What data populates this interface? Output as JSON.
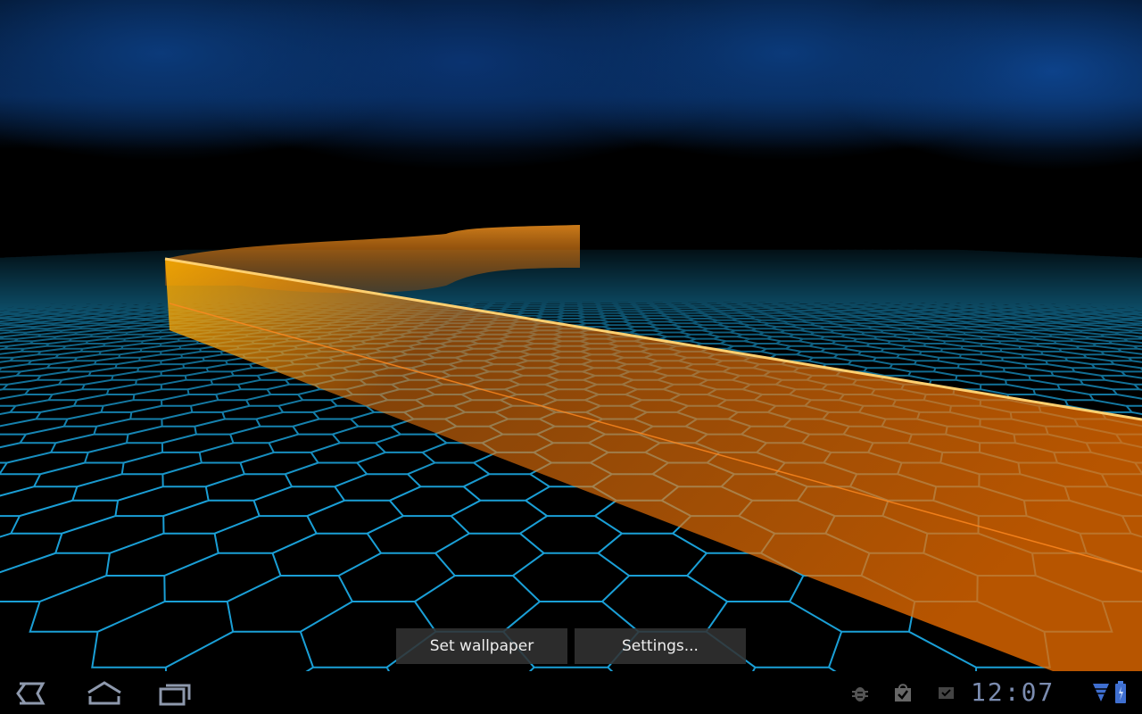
{
  "preview": {
    "set_wallpaper_label": "Set wallpaper",
    "settings_label": "Settings..."
  },
  "system_bar": {
    "time": "12:07",
    "nav_icons": [
      "back-icon",
      "home-icon",
      "recent-apps-icon"
    ],
    "notification_icons": [
      "usb-debugging-icon",
      "market-update-icon",
      "notification-icon"
    ],
    "status_icons": [
      "wifi-signal-icon",
      "battery-charging-icon"
    ]
  },
  "colors": {
    "ribbon": "#f07a10",
    "grid": "#1aa0d8",
    "sky": "#0b3a7a",
    "icon": "#7b8cb0"
  }
}
